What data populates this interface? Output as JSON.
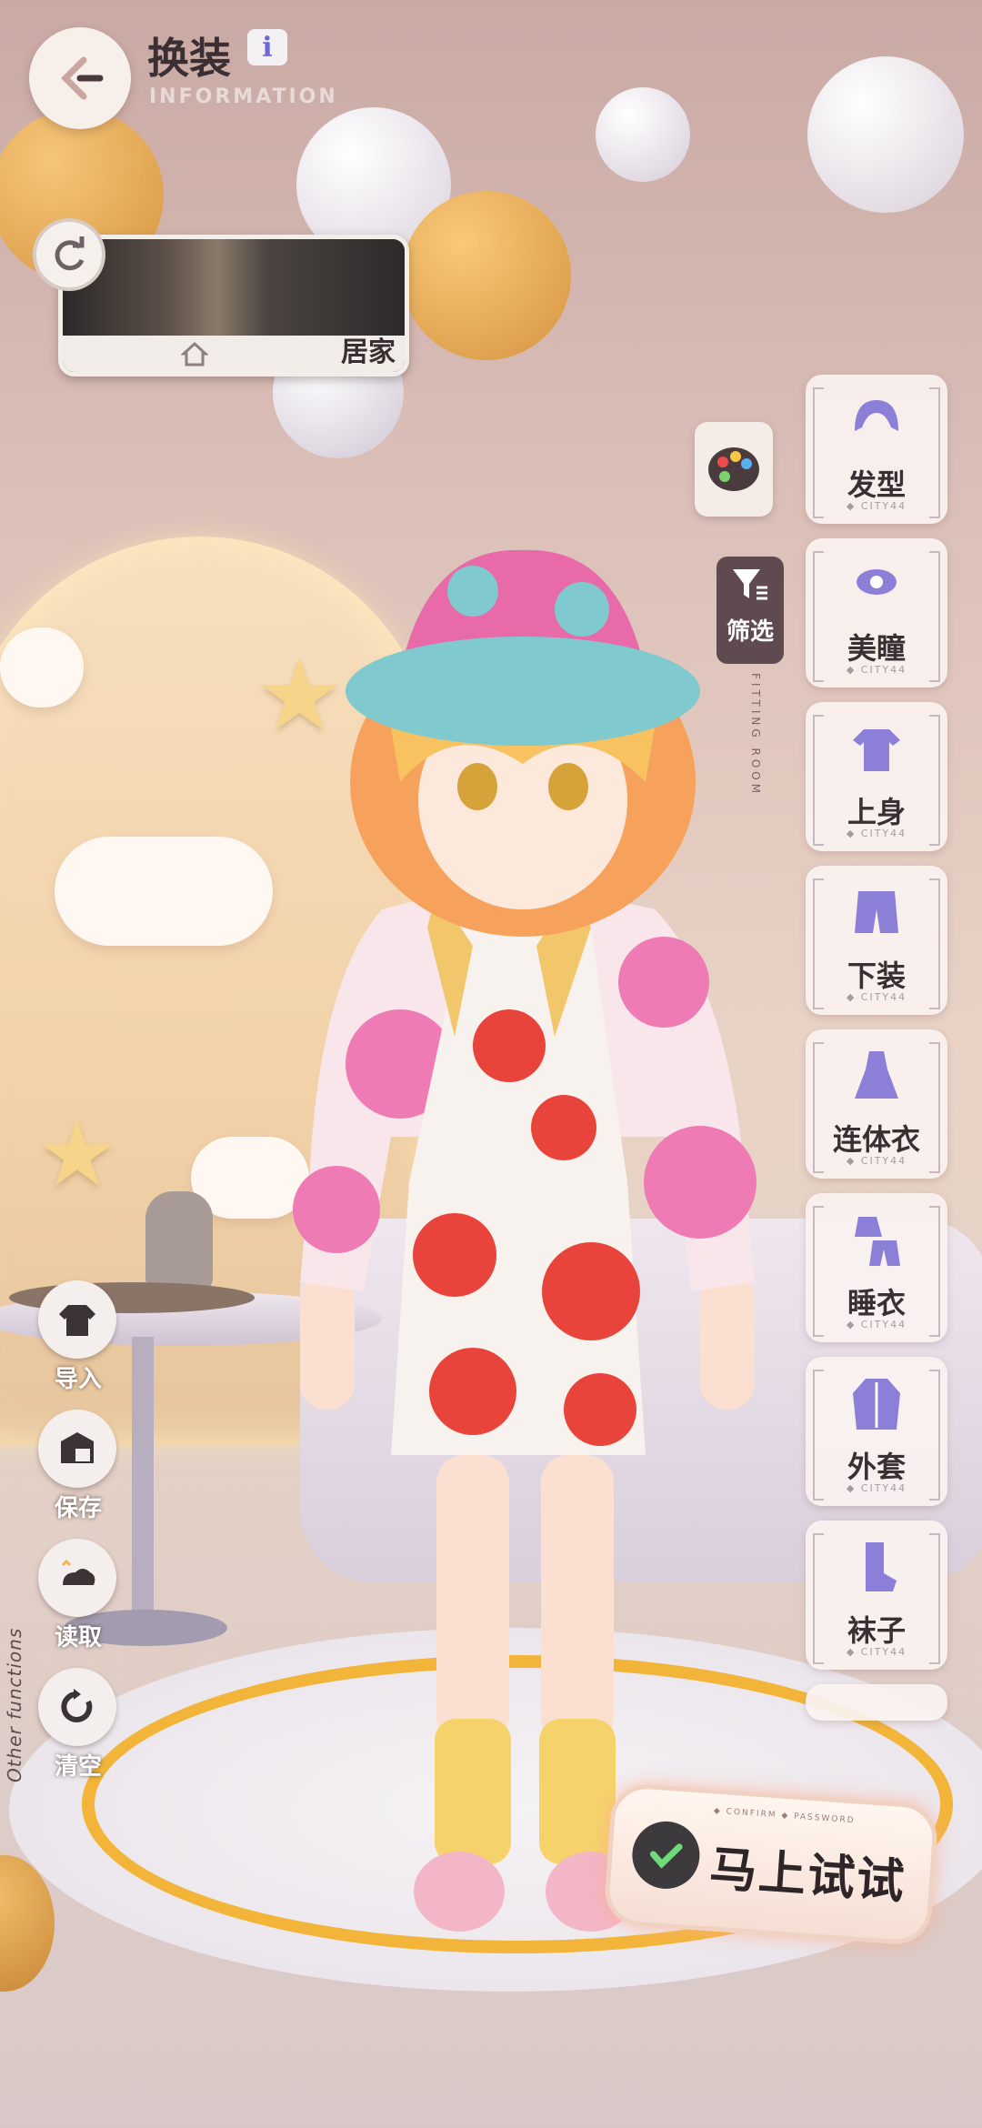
{
  "header": {
    "title": "换装",
    "subtitle": "INFORMATION",
    "back_icon": "back-arrow-icon",
    "info_icon": "i"
  },
  "scene": {
    "label": "居家",
    "home_icon": "house-icon",
    "refresh_icon": "refresh-icon"
  },
  "tools": {
    "palette_icon": "palette-icon",
    "filter_label": "筛选",
    "vertical_text": "FITTING ROOM"
  },
  "categories": [
    {
      "label": "发型",
      "icon": "hair-icon",
      "sub": "◆ CITY44"
    },
    {
      "label": "美瞳",
      "icon": "eye-icon",
      "sub": "◆ CITY44"
    },
    {
      "label": "上身",
      "icon": "shirt-icon",
      "sub": "◆ CITY44"
    },
    {
      "label": "下装",
      "icon": "shorts-icon",
      "sub": "◆ CITY44"
    },
    {
      "label": "连体衣",
      "icon": "dress-icon",
      "sub": "◆ CITY44"
    },
    {
      "label": "睡衣",
      "icon": "pajamas-icon",
      "sub": "◆ CITY44"
    },
    {
      "label": "外套",
      "icon": "coat-icon",
      "sub": "◆ CITY44"
    },
    {
      "label": "袜子",
      "icon": "sock-icon",
      "sub": "◆ CITY44"
    }
  ],
  "side_buttons": [
    {
      "label": "导入",
      "icon": "import-icon"
    },
    {
      "label": "保存",
      "icon": "save-icon"
    },
    {
      "label": "读取",
      "icon": "load-icon"
    },
    {
      "label": "清空",
      "icon": "clear-icon"
    }
  ],
  "side_caption": "Other functions",
  "try_button": {
    "label": "马上试试",
    "sub": "◆ CONFIRM ◆ PASSWORD",
    "icon": "check-icon"
  },
  "colors": {
    "accent_purple": "#6c68d8",
    "hat_pink": "#e86aa8",
    "hat_teal": "#7fc9cf",
    "dress_red": "#e8443c",
    "rug_ring": "#f2b53a"
  }
}
